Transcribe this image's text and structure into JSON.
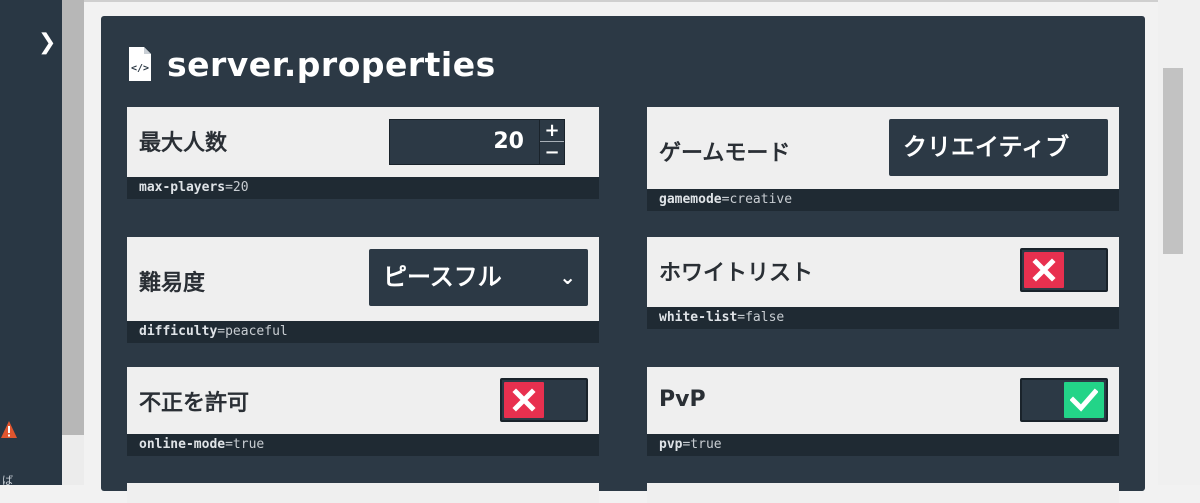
{
  "sidebar": {
    "expand_icon": "chevron-right-icon",
    "warning_icon": "warning-icon",
    "cut_text": "ば"
  },
  "panel": {
    "title": "server.properties",
    "file_icon": "file-code-icon"
  },
  "properties": {
    "max_players": {
      "label": "最大人数",
      "value": "20",
      "plus": "+",
      "minus": "−",
      "meta_key": "max-players",
      "meta_value": "=20"
    },
    "gamemode": {
      "label": "ゲームモード",
      "value": "クリエイティブ",
      "meta_key": "gamemode",
      "meta_value": "=creative"
    },
    "difficulty": {
      "label": "難易度",
      "value": "ピースフル",
      "meta_key": "difficulty",
      "meta_value": "=peaceful"
    },
    "white_list": {
      "label": "ホワイトリスト",
      "state": "off",
      "meta_key": "white-list",
      "meta_value": "=false"
    },
    "online_mode": {
      "label": "不正を許可",
      "state": "off",
      "meta_key": "online-mode",
      "meta_value": "=true"
    },
    "pvp": {
      "label": "PvP",
      "state": "on",
      "meta_key": "pvp",
      "meta_value": "=true"
    }
  },
  "colors": {
    "panel": "#2c3945",
    "toggle_off": "#e8304f",
    "toggle_on": "#23d488"
  }
}
